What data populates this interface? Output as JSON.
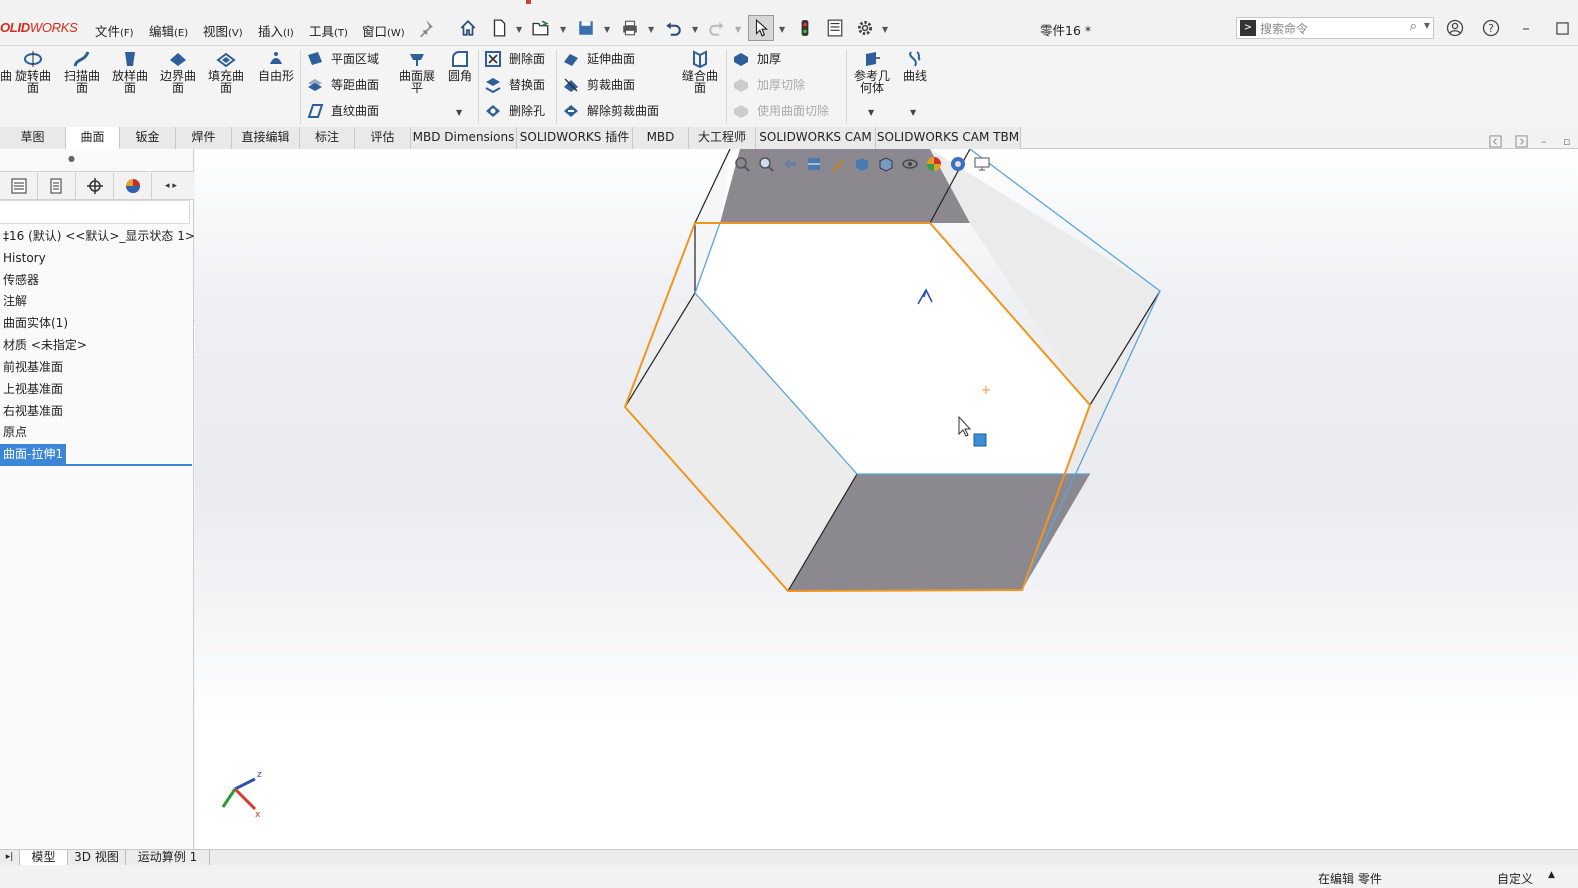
{
  "app": {
    "logo_bold": "OLID",
    "logo_thin": "WORKS",
    "document_title": "零件16 *"
  },
  "menu": [
    {
      "label": "文件",
      "key": "(F)"
    },
    {
      "label": "编辑",
      "key": "(E)"
    },
    {
      "label": "视图",
      "key": "(V)"
    },
    {
      "label": "插入",
      "key": "(I)"
    },
    {
      "label": "工具",
      "key": "(T)"
    },
    {
      "label": "窗口",
      "key": "(W)"
    }
  ],
  "search": {
    "placeholder": "搜索命令"
  },
  "ribbon": {
    "big": [
      "旋转曲面",
      "扫描曲面",
      "放样曲面",
      "边界曲面",
      "填充曲面",
      "自由形",
      "曲面展平",
      "圆角",
      "缝合曲面",
      "参考几何体",
      "曲线"
    ],
    "col1": [
      "平面区域",
      "等距曲面",
      "直纹曲面"
    ],
    "col2": [
      "删除面",
      "替换面",
      "删除孔"
    ],
    "col3": [
      "延伸曲面",
      "剪裁曲面",
      "解除剪裁曲面"
    ],
    "col4": [
      "加厚",
      "加厚切除",
      "使用曲面切除"
    ]
  },
  "tabs": [
    "草图",
    "曲面",
    "钣金",
    "焊件",
    "直接编辑",
    "标注",
    "评估",
    "MBD Dimensions",
    "SOLIDWORKS 插件",
    "MBD",
    "大工程师",
    "SOLIDWORKS CAM",
    "SOLIDWORKS CAM TBM"
  ],
  "active_tab": "曲面",
  "feature_tree": {
    "root": "‡16 (默认) <<默认>_显示状态 1>",
    "items": [
      "History",
      "传感器",
      "注解",
      "曲面实体(1)",
      "材质 <未指定>",
      "前视基准面",
      "上视基准面",
      "右视基准面",
      "原点",
      "曲面-拉伸1"
    ],
    "selected": "曲面-拉伸1"
  },
  "triad": {
    "z": "z",
    "x": "x"
  },
  "bottom_tabs": [
    "模型",
    "3D 视图",
    "运动算例 1"
  ],
  "status": {
    "left": "在编辑 零件",
    "right": "自定义"
  },
  "colors": {
    "accent": "#3b86d6",
    "edge_selected": "#f0961e",
    "edge_normal": "#5aa6d8",
    "face_dark": "#8c8890",
    "face_light": "#efefef",
    "logo": "#d52b1e"
  }
}
